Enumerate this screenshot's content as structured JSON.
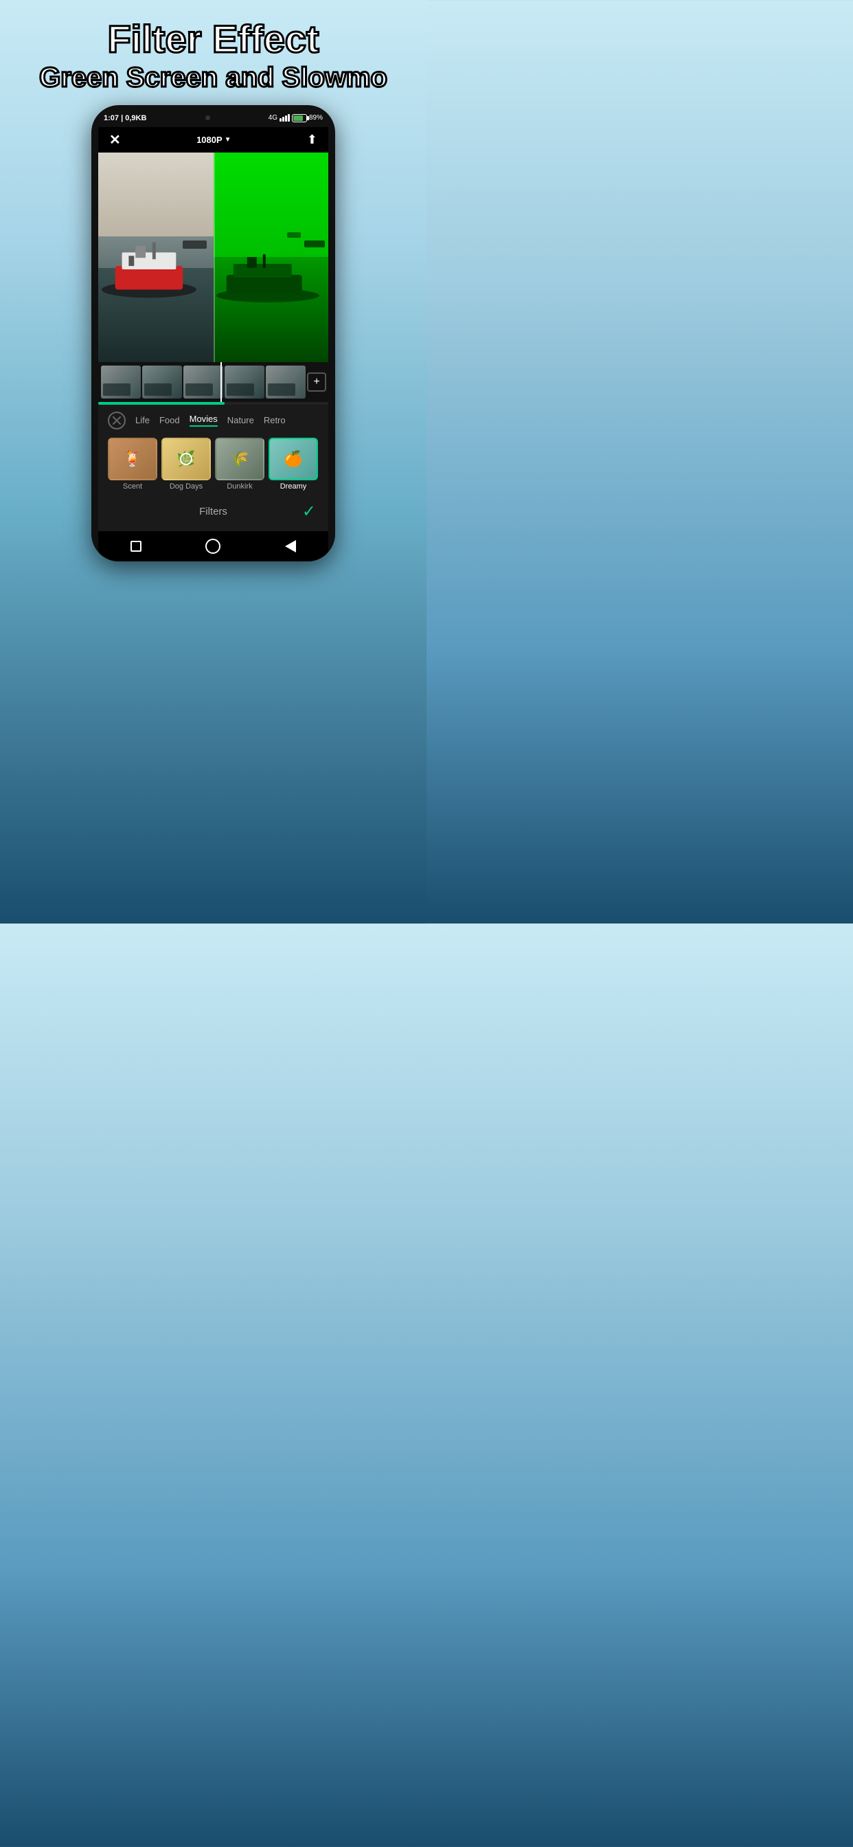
{
  "app": {
    "title_line1": "Filter Effect",
    "title_line2": "Green Screen and Slowmo"
  },
  "phone_iphone": {
    "status_bar": {
      "time": "1:07 | 0,9KB",
      "signal": "4G",
      "battery": "89%"
    },
    "toolbar": {
      "resolution": "1080P",
      "resolution_arrow": "▼"
    }
  },
  "filter_section": {
    "categories": [
      {
        "id": "none",
        "label": "",
        "type": "icon"
      },
      {
        "id": "life",
        "label": "Life"
      },
      {
        "id": "food",
        "label": "Food"
      },
      {
        "id": "movies",
        "label": "Movies",
        "active": true
      },
      {
        "id": "nature",
        "label": "Nature"
      },
      {
        "id": "retro",
        "label": "Retro"
      }
    ],
    "filters": [
      {
        "id": "scent",
        "label": "Scent"
      },
      {
        "id": "dogdays",
        "label": "Dog Days",
        "has_adjust": true
      },
      {
        "id": "dunkirk",
        "label": "Dunkirk"
      },
      {
        "id": "dreamy",
        "label": "Dreamy",
        "active": true
      }
    ],
    "footer_label": "Filters",
    "check_icon": "✓"
  },
  "android_nav": {
    "square": "□",
    "circle": "○",
    "triangle": "◁"
  },
  "colors": {
    "accent": "#00cc88",
    "green_screen": "#00cc00",
    "active_border": "#00cc88"
  }
}
